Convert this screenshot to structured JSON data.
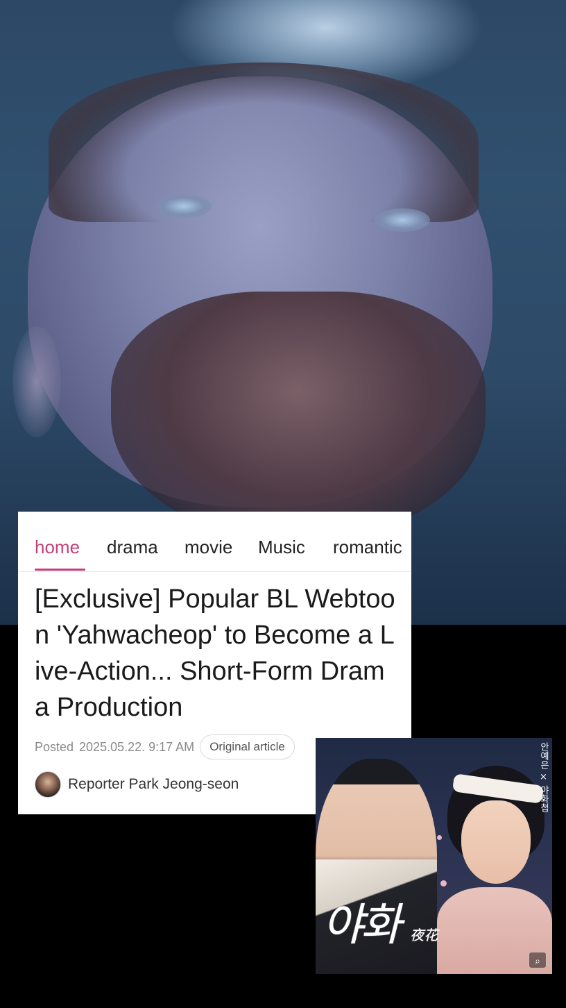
{
  "nav": {
    "tabs": [
      {
        "label": "home",
        "active": true
      },
      {
        "label": "drama",
        "active": false
      },
      {
        "label": "movie",
        "active": false
      },
      {
        "label": "Music",
        "active": false
      },
      {
        "label": "romantic",
        "active": false
      }
    ]
  },
  "article": {
    "headline": "[Exclusive] Popular BL Webtoon 'Yahwacheop' to Become a Live-Action... Short-Form Drama Production",
    "posted_label": "Posted",
    "posted_date": "2025.05.22. 9:17 AM",
    "original_article_label": "Original article",
    "reporter": "Reporter Park Jeong-seon"
  },
  "cover": {
    "logo_text": "야화",
    "logo_sub": "夜花",
    "vertical_text": "안예은 × 야화첩",
    "zoom_icon": "zoom-icon"
  },
  "colors": {
    "accent": "#c2407a",
    "card_bg": "#ffffff",
    "page_bg": "#000000"
  }
}
